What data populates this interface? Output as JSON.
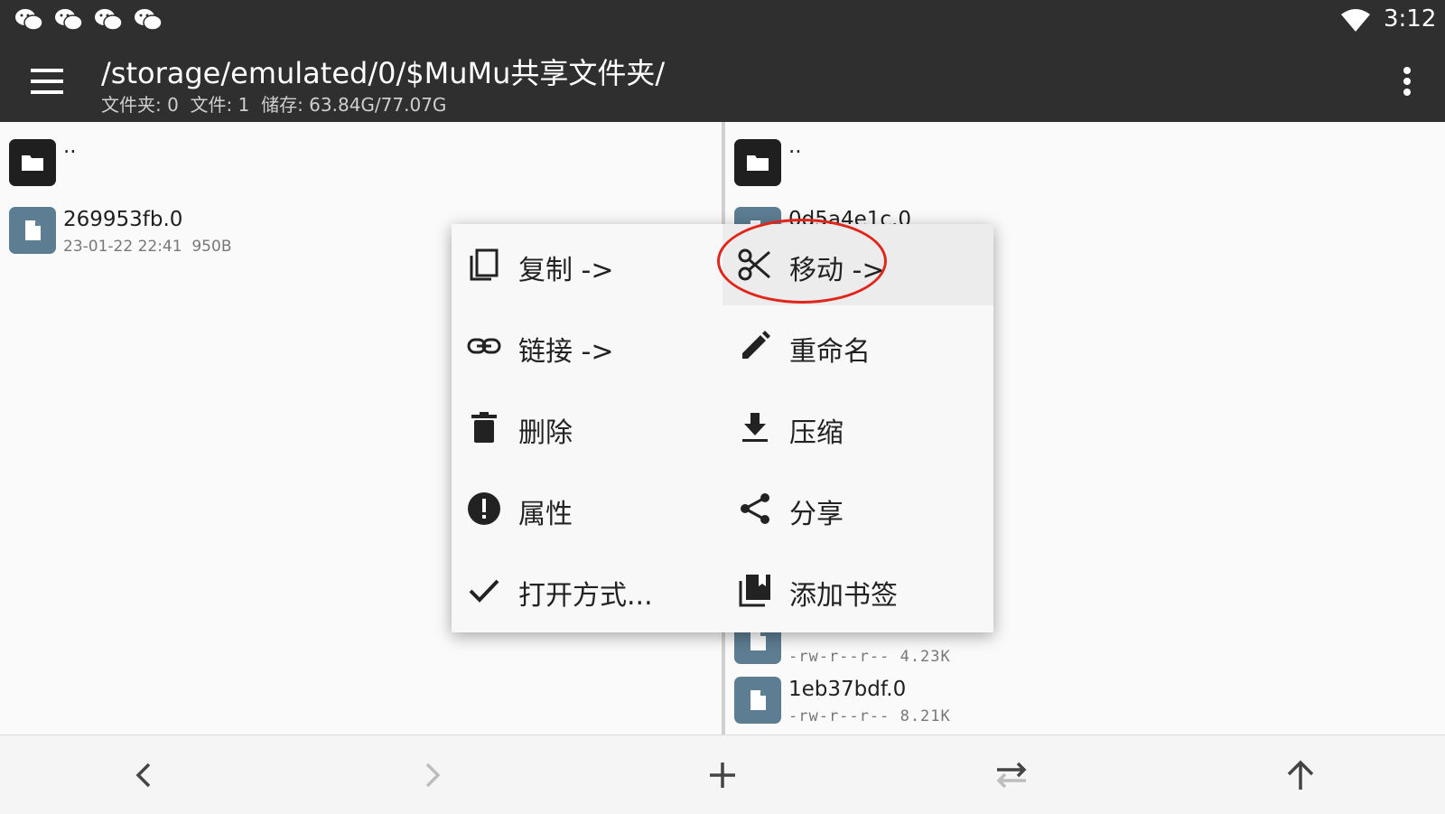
{
  "status_bar": {
    "notification_icons": [
      "wechat-icon",
      "wechat-icon",
      "wechat-icon",
      "wechat-icon"
    ],
    "wifi_icon": "wifi-icon",
    "time": "3:12"
  },
  "app_bar": {
    "menu_icon": "hamburger-menu-icon",
    "path": "/storage/emulated/0/$MuMu共享文件夹/",
    "stats": "文件夹: 0  文件: 1  储存: 63.84G/77.07G",
    "overflow_icon": "more-vert-icon"
  },
  "left_pane": {
    "items": [
      {
        "name": "..",
        "meta": "",
        "icon": "folder-icon"
      },
      {
        "name": "269953fb.0",
        "meta": "23-01-22 22:41  950B",
        "icon": "file-icon"
      }
    ]
  },
  "right_pane": {
    "items": [
      {
        "name": "..",
        "meta": "",
        "icon": "folder-icon"
      },
      {
        "name": "0d5a4e1c.0",
        "meta": "",
        "icon": "file-icon"
      },
      {
        "name": "",
        "meta": "-rw-r--r-- 4.23K",
        "icon": "file-icon"
      },
      {
        "name": "1eb37bdf.0",
        "meta": "-rw-r--r-- 8.21K",
        "icon": "file-icon"
      }
    ]
  },
  "context_menu": {
    "items": [
      {
        "label": "复制 ->",
        "icon": "copy-icon"
      },
      {
        "label": "移动 ->",
        "icon": "scissors-icon",
        "highlighted": true,
        "circled_in_red": true
      },
      {
        "label": "链接 ->",
        "icon": "link-icon"
      },
      {
        "label": "重命名",
        "icon": "pencil-icon"
      },
      {
        "label": "删除",
        "icon": "trash-icon"
      },
      {
        "label": "压缩",
        "icon": "download-icon"
      },
      {
        "label": "属性",
        "icon": "info-exclamation-icon"
      },
      {
        "label": "分享",
        "icon": "share-icon"
      },
      {
        "label": "打开方式...",
        "icon": "check-icon"
      },
      {
        "label": "添加书签",
        "icon": "bookmarks-icon"
      }
    ]
  },
  "bottom_bar": {
    "buttons": [
      "back-arrow-icon",
      "forward-arrow-icon",
      "add-icon",
      "swap-icon",
      "up-arrow-icon"
    ]
  },
  "colors": {
    "toolbar": "#2f2f2f",
    "file_icon_bg": "#5d7d92",
    "folder_icon_bg": "#1f1f1f",
    "annotation_ring": "#e0251b"
  }
}
